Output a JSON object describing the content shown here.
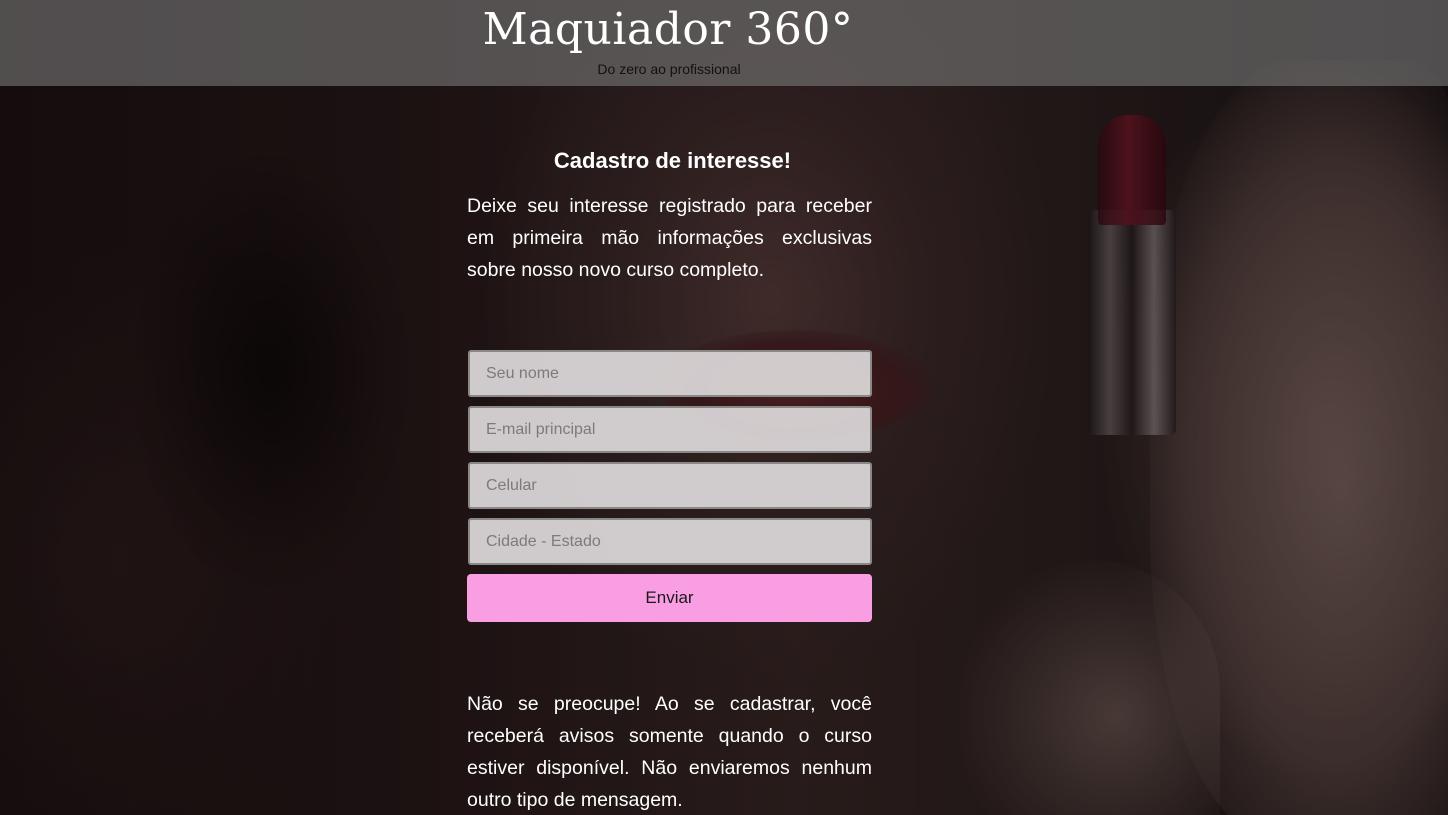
{
  "header": {
    "title": "Maquiador 360°",
    "subtitle": "Do zero ao profissional"
  },
  "main": {
    "heading": "Cadastro de interesse!",
    "intro": "Deixe seu interesse registrado para receber em primeira mão informações exclusivas sobre nosso novo curso completo.",
    "note": "Não se preocupe! Ao se cadastrar, você receberá avisos somente quando o curso estiver disponível. Não enviaremos nenhum outro tipo de mensagem."
  },
  "form": {
    "name_placeholder": "Seu nome",
    "email_placeholder": "E-mail principal",
    "phone_placeholder": "Celular",
    "city_placeholder": "Cidade - Estado",
    "submit_label": "Enviar"
  },
  "colors": {
    "accent": "#f99ee2",
    "header_bar": "#787878"
  }
}
